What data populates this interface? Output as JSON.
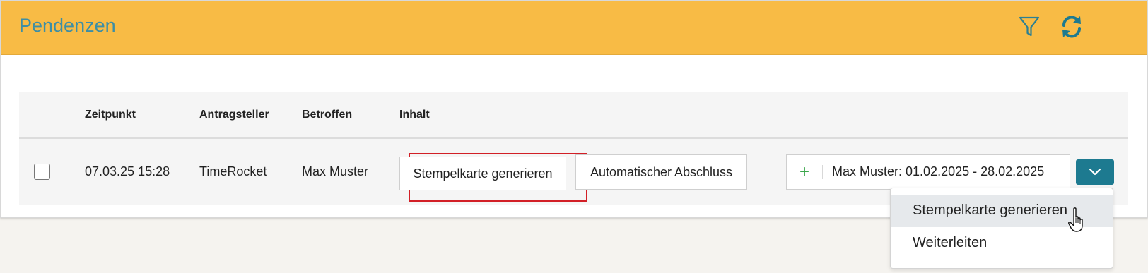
{
  "header": {
    "title": "Pendenzen",
    "filter_icon": "filter-icon",
    "refresh_icon": "refresh-icon",
    "bg_color": "#f8bb45",
    "accent_color": "#1d7a90"
  },
  "table": {
    "columns": [
      "Zeitpunkt",
      "Antragsteller",
      "Betroffen",
      "Inhalt"
    ],
    "rows": [
      {
        "checked": false,
        "zeitpunkt": "07.03.25 15:28",
        "antragsteller": "TimeRocket",
        "betroffen": "Max Muster",
        "actions": {
          "stempelkarte": "Stempelkarte generieren",
          "abschluss": "Automatischer Abschluss",
          "plus_icon": "plus-icon",
          "range_label": "Max Muster: 01.02.2025 - 28.02.2025",
          "dropdown_icon": "chevron-down-icon"
        }
      }
    ]
  },
  "dropdown_menu": {
    "items": [
      "Stempelkarte generieren",
      "Weiterleiten"
    ],
    "hovered_index": 0
  }
}
